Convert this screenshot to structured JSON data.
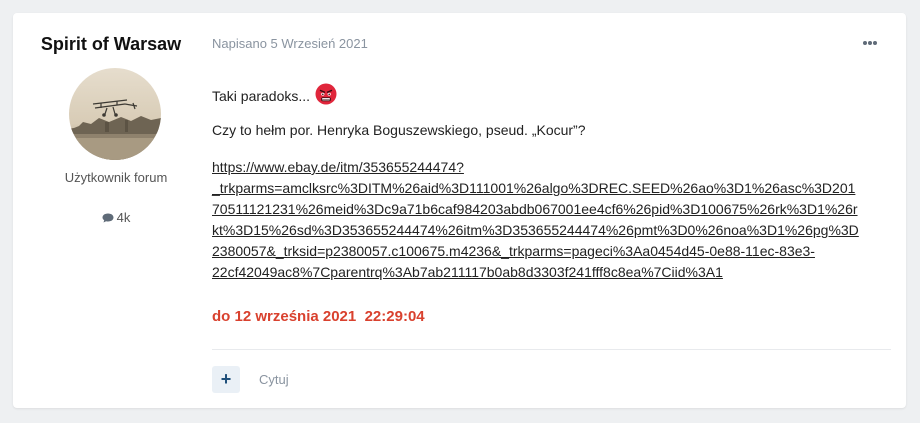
{
  "author": {
    "name": "Spirit of Warsaw",
    "role": "Użytkownik forum",
    "post_count": "4k"
  },
  "post": {
    "meta": "Napisano 5 Wrzesień 2021",
    "line1": "Taki paradoks...",
    "line2": "Czy to hełm por. Henryka Boguszewskiego, pseud. „Kocur”?",
    "link_lines": [
      "https://www.ebay.de/itm/353655244474?",
      "_trkparms=amclksrc%3DITM%26aid%3D111001%26algo%3DREC.SEED%26ao%3D1%26asc%3D201",
      "70511121231%26meid%3Dc9a71b6caf984203abdb067001ee4cf6%26pid%3D100675%26rk%3D1%26r",
      "kt%3D15%26sd%3D353655244474%26itm%3D353655244474%26pmt%3D0%26noa%3D1%26pg%3D",
      "2380057&_trksid=p2380057.c100675.m4236&_trkparms=pageci%3Aa0454d45-0e88-11ec-83e3-",
      "22cf42049ac8%7Cparentrq%3Ab7ab211117b0ab8d3303f241fff8c8ea%7Ciid%3A1"
    ],
    "date_red": "do 12 września 2021  22:29:04"
  },
  "actions": {
    "plus_label": "+",
    "quote_label": "Cytuj"
  },
  "colors": {
    "accent_red": "#d9412e",
    "button_bg": "#eaf0f6",
    "button_fg": "#1e4f7a",
    "meta_gray": "#8a94a0"
  },
  "icons": [
    "chat-bubble-icon",
    "more-options-icon",
    "angry-face-emoji-icon",
    "plus-icon"
  ]
}
